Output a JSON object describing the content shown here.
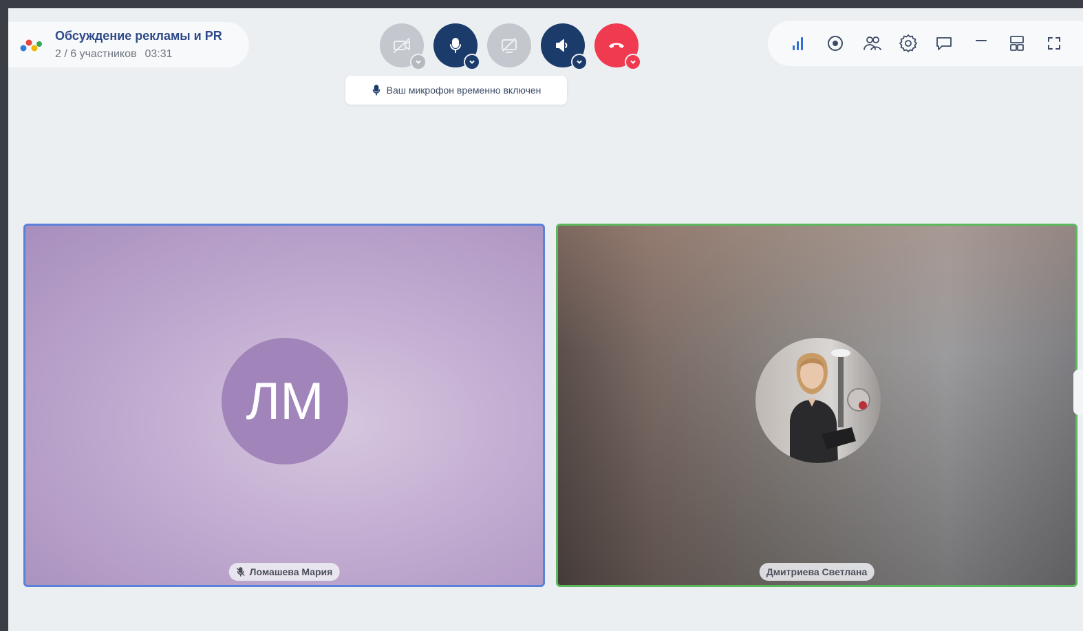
{
  "conference": {
    "title": "Обсуждение рекламы и PR",
    "participants": "2 / 6 участников",
    "timer": "03:31"
  },
  "controls": [
    {
      "name": "camera-toggle",
      "state": "off",
      "icon": "camera-off-icon"
    },
    {
      "name": "microphone-toggle",
      "state": "on",
      "icon": "microphone-icon"
    },
    {
      "name": "screen-share-toggle",
      "state": "off",
      "icon": "screen-share-off-icon"
    },
    {
      "name": "speaker-toggle",
      "state": "on",
      "icon": "speaker-icon"
    },
    {
      "name": "hang-up",
      "state": "active",
      "icon": "phone-hangup-icon"
    }
  ],
  "tooltip": {
    "text": "Ваш микрофон временно включен",
    "icon": "microphone-icon"
  },
  "toolbar": {
    "icons": [
      "signal-icon",
      "record-icon",
      "participants-icon",
      "settings-icon",
      "chat-icon",
      "minimize-icon",
      "layout-icon",
      "fullscreen-icon"
    ]
  },
  "participants": [
    {
      "name": "Ломашева Мария",
      "initials": "ЛМ",
      "muted": true,
      "icon": "microphone-off-icon"
    },
    {
      "name": "Дмитриева Светлана",
      "initials": "",
      "muted": false
    }
  ],
  "colors": {
    "accent_navy": "#1b3b6a",
    "hangup_red": "#ef3a4f",
    "tile_active_blue": "#5a82d8",
    "tile_speaking_green": "#5cb85c",
    "avatar_purple": "#a084ba"
  }
}
